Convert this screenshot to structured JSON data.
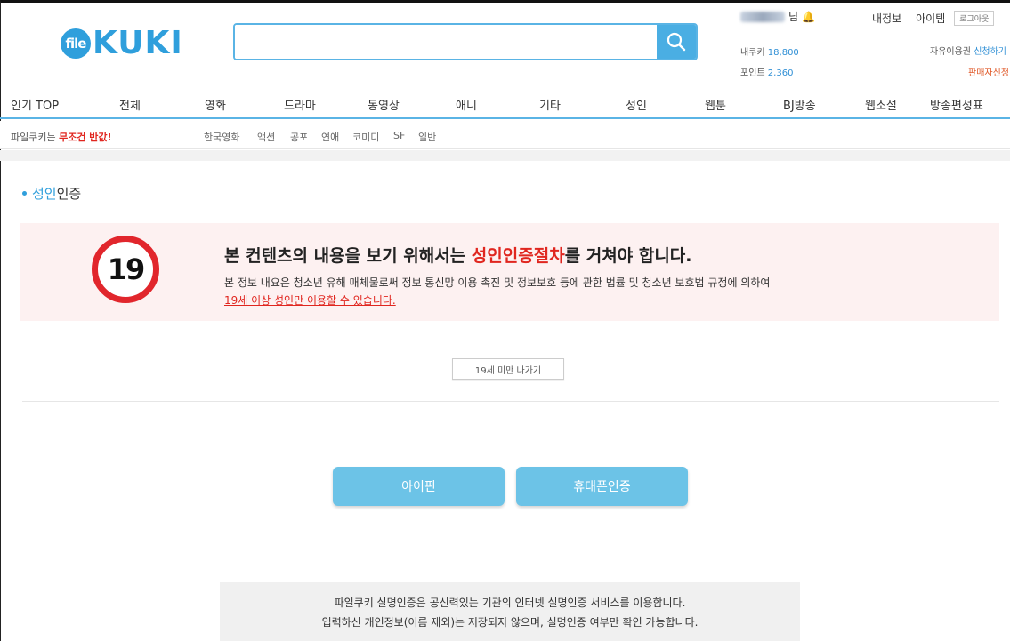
{
  "logo": {
    "badge": "file",
    "text": "KUKI"
  },
  "search": {
    "value": "",
    "placeholder": ""
  },
  "user": {
    "suffix": "님",
    "kuki_label": "내쿠키",
    "kuki_value": "18,800",
    "point_label": "포인트",
    "point_value": "2,360"
  },
  "top_links": {
    "myinfo": "내정보",
    "item": "아이템",
    "logout": "로그아웃"
  },
  "free_use": {
    "label": "자유이용권",
    "link": "신청하기"
  },
  "seller": "판매자신청",
  "nav": [
    "인기 TOP",
    "전체",
    "영화",
    "드라마",
    "동영상",
    "애니",
    "기타",
    "성인",
    "웹툰",
    "BJ방송",
    "웹소설",
    "방송편성표"
  ],
  "promo": {
    "prefix": "파일쿠키는 ",
    "highlight": "무조건 반값!"
  },
  "genres": [
    "한국영화",
    "액션",
    "공포",
    "연애",
    "코미디",
    "SF",
    "일반"
  ],
  "section": {
    "accent": "성인",
    "rest": "인증"
  },
  "notice": {
    "badge": "19",
    "title_pre": "본 컨텐츠의 내용을 보기 위해서는 ",
    "title_red": "성인인증절차",
    "title_post": "를 거쳐야 합니다.",
    "desc": "본 정보 내요은 청소년 유해 매체물로써 정보 통신망 이용 촉진 및 정보보호 등에 관한 법률 및 청소년 보호법 규정에 의하여",
    "link": "19세 이상 성인만 이용할 수 있습니다."
  },
  "exit_button": "19세 미만 나가기",
  "auth_buttons": {
    "ipin": "아이핀",
    "phone": "휴대폰인증"
  },
  "info": {
    "line1": "파일쿠키 실명인증은 공신력있는 기관의 인터넷 실명인증 서비스를 이용합니다.",
    "line2": "입력하신 개인정보(이름 제외)는 저장되지 않으며, 실명인증 여부만 확인 가능합니다."
  },
  "colors": {
    "brand": "#2f9fdc",
    "alert": "#e0261f",
    "button": "#6cc3e7"
  }
}
